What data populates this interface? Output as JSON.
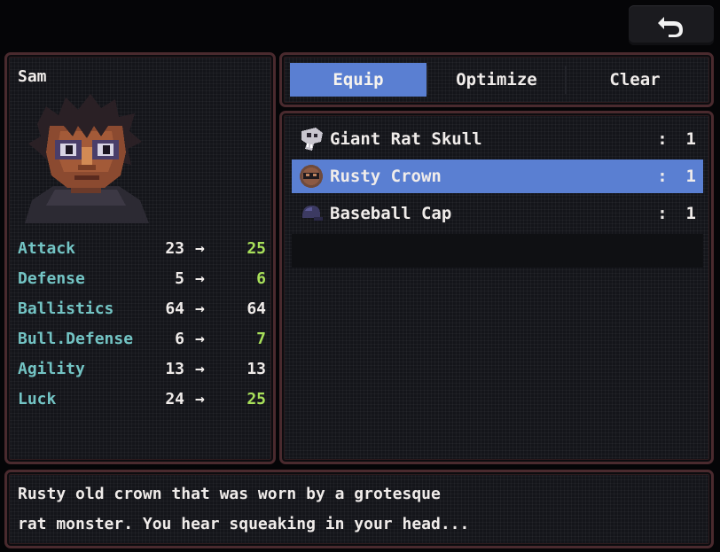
{
  "character": {
    "name": "Sam",
    "stats": [
      {
        "label": "Attack",
        "old": "23",
        "arrow": "→",
        "new": "25",
        "increased": true
      },
      {
        "label": "Defense",
        "old": "5",
        "arrow": "→",
        "new": "6",
        "increased": true
      },
      {
        "label": "Ballistics",
        "old": "64",
        "arrow": "→",
        "new": "64",
        "increased": false
      },
      {
        "label": "Bull.Defense",
        "old": "6",
        "arrow": "→",
        "new": "7",
        "increased": true
      },
      {
        "label": "Agility",
        "old": "13",
        "arrow": "→",
        "new": "13",
        "increased": false
      },
      {
        "label": "Luck",
        "old": "24",
        "arrow": "→",
        "new": "25",
        "increased": true
      }
    ]
  },
  "tabs": [
    {
      "label": "Equip",
      "active": true
    },
    {
      "label": "Optimize",
      "active": false
    },
    {
      "label": "Clear",
      "active": false
    }
  ],
  "items": [
    {
      "name": "Giant Rat Skull",
      "colon": ":",
      "qty": "1",
      "icon": "skull-icon",
      "selected": false
    },
    {
      "name": "Rusty Crown",
      "colon": ":",
      "qty": "1",
      "icon": "crown-icon",
      "selected": true
    },
    {
      "name": "Baseball Cap",
      "colon": ":",
      "qty": "1",
      "icon": "cap-icon",
      "selected": false
    }
  ],
  "description": {
    "line1": "Rusty old crown that was worn by a grotesque",
    "line2": "rat monster. You hear squeaking in your head..."
  },
  "colors": {
    "accent": "#5a7fd2",
    "stat_label": "#73c4c4",
    "stat_increase": "#a8e05a",
    "panel_border": "#4a2a2e"
  }
}
